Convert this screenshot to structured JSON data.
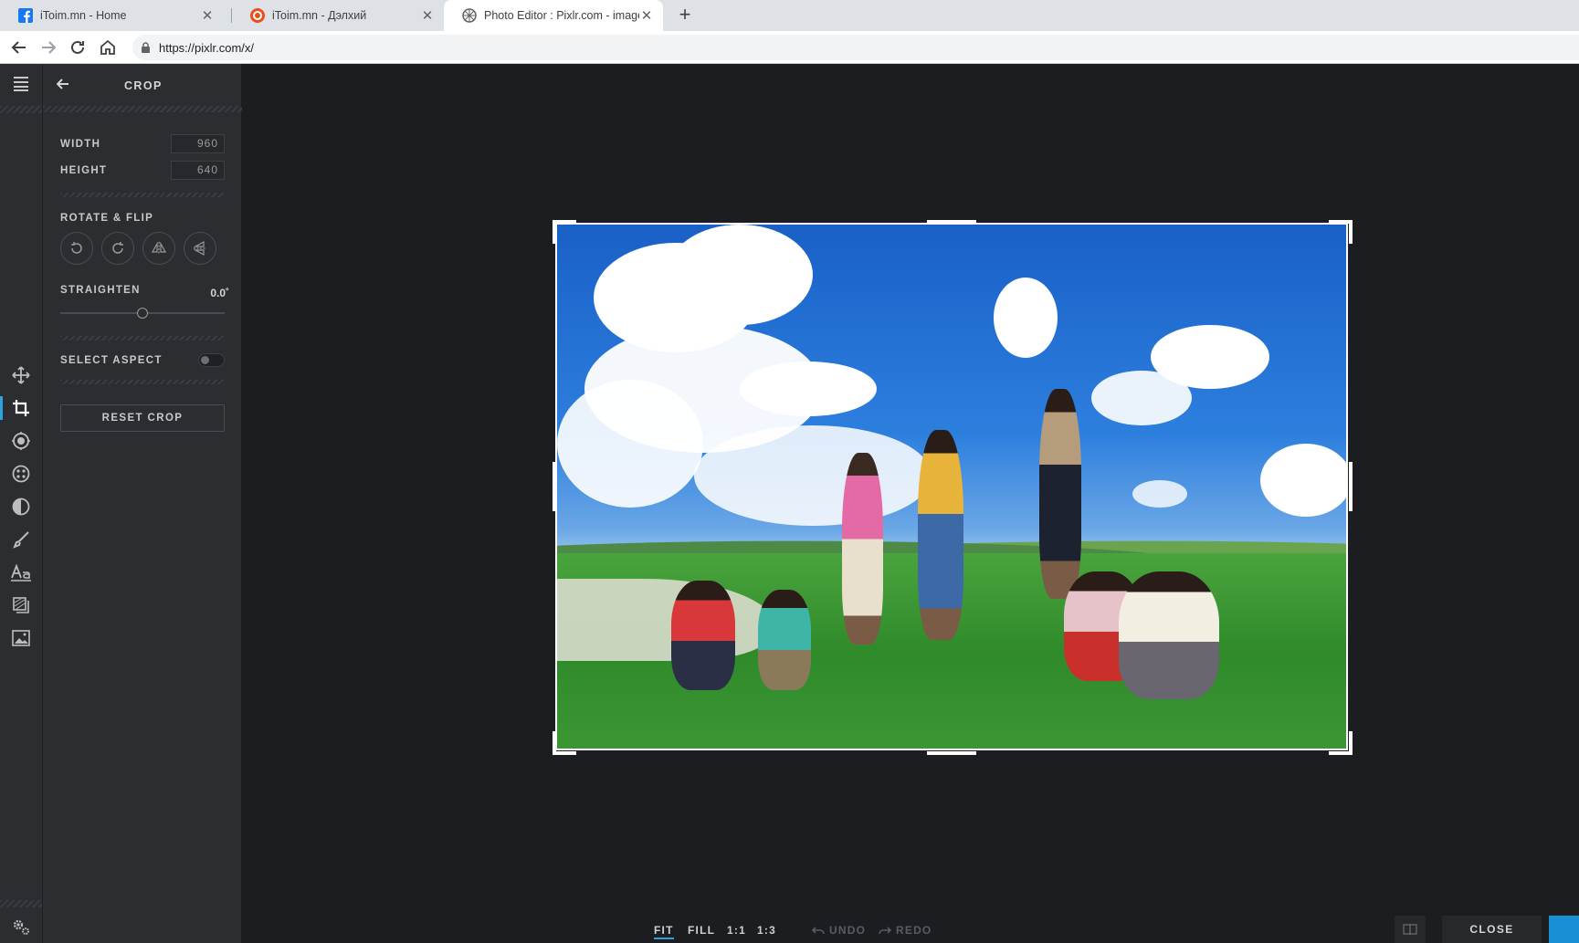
{
  "browser": {
    "tabs": [
      {
        "title": "iToim.mn - Home",
        "icon": "facebook-icon"
      },
      {
        "title": "iToim.mn - Дэлхий",
        "icon": "itoim-icon"
      },
      {
        "title": "Photo Editor : Pixlr.com - image e",
        "icon": "pixlr-icon"
      }
    ],
    "url": "https://pixlr.com/x/"
  },
  "panel": {
    "title": "CROP",
    "width_label": "WIDTH",
    "width_value": "960",
    "height_label": "HEIGHT",
    "height_value": "640",
    "rotate_label": "ROTATE & FLIP",
    "straighten_label": "STRAIGHTEN",
    "straighten_value": "0.0˚",
    "straighten_fraction": 0.5,
    "aspect_label": "SELECT ASPECT",
    "aspect_enabled": false,
    "reset_label": "RESET CROP"
  },
  "tools": [
    "menu-icon",
    "move-icon",
    "crop-icon",
    "adjust-icon",
    "filter-icon",
    "effect-icon",
    "brush-icon",
    "text-icon",
    "layer-icon",
    "image-icon",
    "settings-icon"
  ],
  "active_tool": "crop-icon",
  "bottom": {
    "fit": "FIT",
    "fill": "FILL",
    "one_one": "1:1",
    "one_three": "1:3",
    "undo": "UNDO",
    "redo": "REDO",
    "close": "CLOSE"
  },
  "colors": {
    "accent": "#2ea1e0",
    "panel_bg": "#2b2d31",
    "canvas_bg": "#1c1d21"
  }
}
